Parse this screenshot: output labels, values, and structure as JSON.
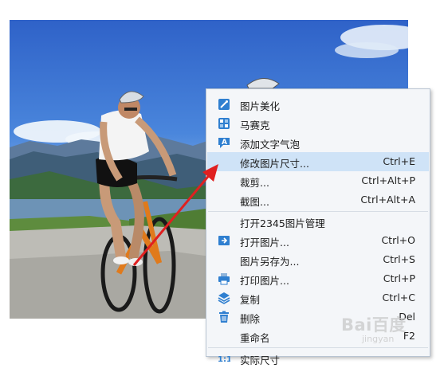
{
  "menu": {
    "items": [
      {
        "label": "图片美化",
        "shortcut": "",
        "icon": "wand-icon"
      },
      {
        "label": "马赛克",
        "shortcut": "",
        "icon": "mosaic-icon"
      },
      {
        "label": "添加文字气泡",
        "shortcut": "",
        "icon": "text-bubble-icon"
      },
      {
        "label": "修改图片尺寸...",
        "shortcut": "Ctrl+E",
        "icon": "",
        "highlighted": true
      },
      {
        "label": "裁剪...",
        "shortcut": "Ctrl+Alt+P",
        "icon": ""
      },
      {
        "label": "截图...",
        "shortcut": "Ctrl+Alt+A",
        "icon": ""
      },
      {
        "label": "打开2345图片管理",
        "shortcut": "",
        "icon": ""
      },
      {
        "label": "打开图片...",
        "shortcut": "Ctrl+O",
        "icon": "open-folder-icon"
      },
      {
        "label": "图片另存为...",
        "shortcut": "Ctrl+S",
        "icon": ""
      },
      {
        "label": "打印图片...",
        "shortcut": "Ctrl+P",
        "icon": "printer-icon"
      },
      {
        "label": "复制",
        "shortcut": "Ctrl+C",
        "icon": "copy-icon"
      },
      {
        "label": "删除",
        "shortcut": "Del",
        "icon": "trash-icon"
      },
      {
        "label": "重命名",
        "shortcut": "F2",
        "icon": ""
      },
      {
        "label": "实际尺寸",
        "shortcut": "",
        "icon": "actual-size-icon"
      }
    ]
  },
  "watermark": {
    "text": "Bai百度",
    "sub": "jingyan"
  },
  "colors": {
    "highlight": "#cfe3f7",
    "arrow": "#e02020",
    "icon_blue": "#2f7fd0"
  }
}
